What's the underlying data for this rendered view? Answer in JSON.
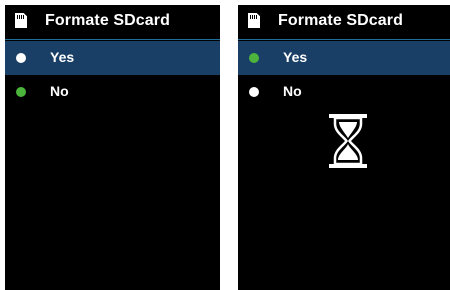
{
  "colors": {
    "screen_bg": "#000000",
    "highlight": "#1a3f66",
    "title_divider": "#1e6f9a",
    "bullet_active": "#4cb43c",
    "bullet_inactive": "#ffffff",
    "text": "#ffffff"
  },
  "screens": [
    {
      "title": "Formate SDcard",
      "icon": "sd-card-icon",
      "items": [
        {
          "label": "Yes",
          "selected": true,
          "bullet": "white"
        },
        {
          "label": "No",
          "selected": false,
          "bullet": "green"
        }
      ]
    },
    {
      "title": "Formate SDcard",
      "icon": "sd-card-icon",
      "items": [
        {
          "label": "Yes",
          "selected": true,
          "bullet": "green"
        },
        {
          "label": "No",
          "selected": false,
          "bullet": "white"
        }
      ],
      "busy_indicator": "hourglass-icon"
    }
  ]
}
